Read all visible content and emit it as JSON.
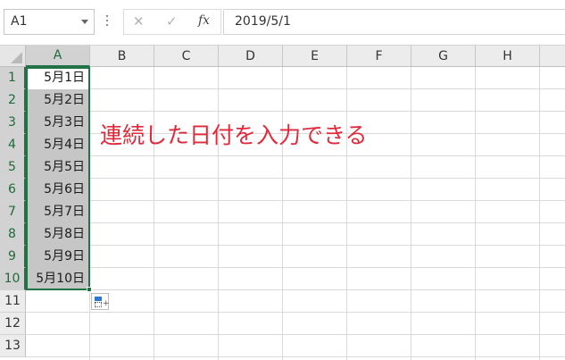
{
  "name_box": {
    "value": "A1"
  },
  "formula_bar": {
    "cancel_icon": "✕",
    "enter_icon": "✓",
    "function_icon": "fx",
    "value": "2019/5/1"
  },
  "sheet": {
    "columns": [
      "A",
      "B",
      "C",
      "D",
      "E",
      "F",
      "G",
      "H"
    ],
    "rows": [
      "1",
      "2",
      "3",
      "4",
      "5",
      "6",
      "7",
      "8",
      "9",
      "10",
      "11",
      "12",
      "13"
    ],
    "column_a_values": [
      "5月1日",
      "5月2日",
      "5月3日",
      "5月4日",
      "5月5日",
      "5月6日",
      "5月7日",
      "5月8日",
      "5月9日",
      "5月10日"
    ],
    "selected_range": "A1:A10",
    "active_cell": "A1"
  },
  "annotation": {
    "text": "連続した日付を入力できる",
    "color": "#e02a3b"
  },
  "colors": {
    "accent": "#217346",
    "selection_fill": "#c6c6c6",
    "header_fill": "#ececec"
  },
  "icons": {
    "name_box_dropdown": "chevron-down-icon",
    "auto_fill_options": "auto-fill-options-icon"
  }
}
